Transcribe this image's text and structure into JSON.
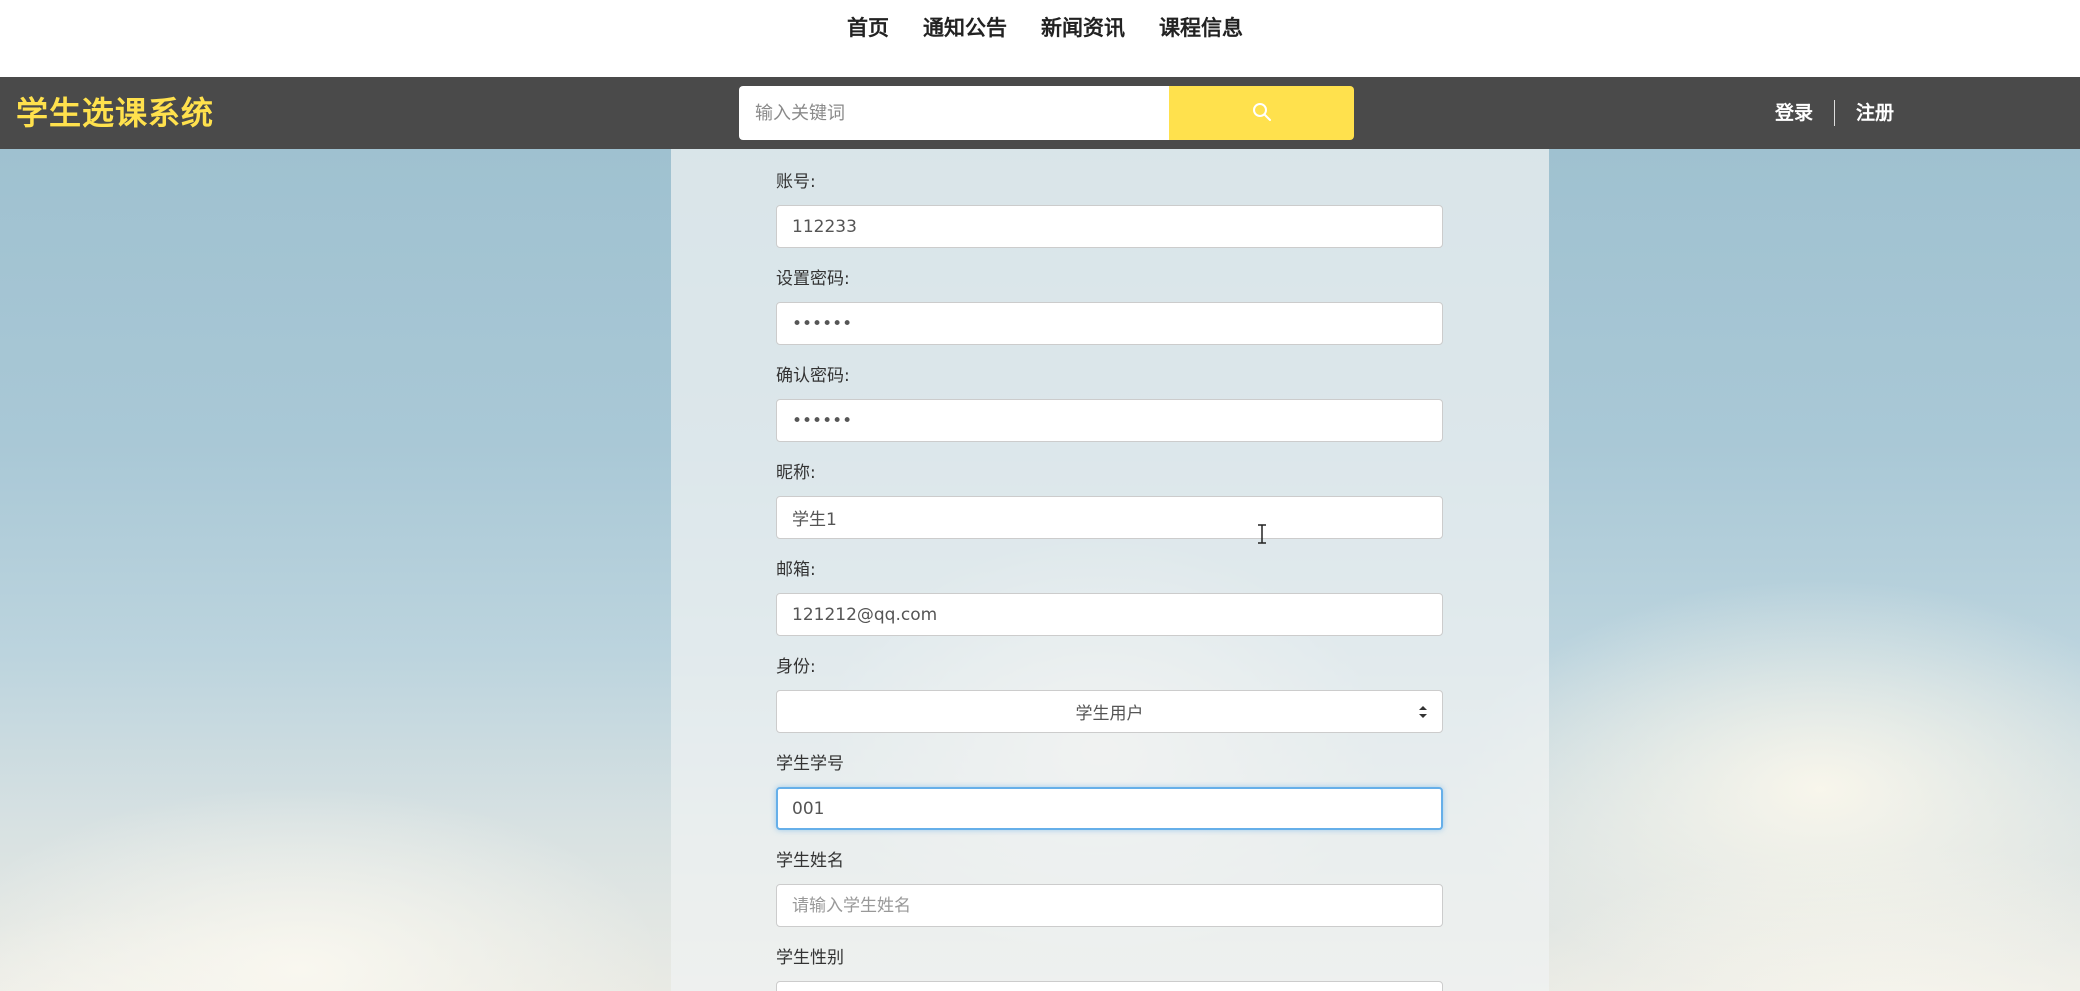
{
  "topnav": {
    "links": [
      "首页",
      "通知公告",
      "新闻资讯",
      "课程信息"
    ]
  },
  "header": {
    "brand": "学生选课系统",
    "search_placeholder": "输入关键词",
    "search_icon": "search-icon",
    "login": "登录",
    "register": "注册"
  },
  "colors": {
    "accent": "#ffe14d",
    "header_bg": "#4a4a4a",
    "focus": "#66afe9"
  },
  "form": {
    "account": {
      "label": "账号:",
      "value": "112233"
    },
    "password": {
      "label": "设置密码:",
      "value": "••••••"
    },
    "confirm_password": {
      "label": "确认密码:",
      "value": "••••••"
    },
    "nickname": {
      "label": "昵称:",
      "value": "学生1"
    },
    "email": {
      "label": "邮箱:",
      "value": "121212@qq.com"
    },
    "role": {
      "label": "身份:",
      "selected": "学生用户"
    },
    "student_no": {
      "label": "学生学号",
      "value": "001"
    },
    "student_name": {
      "label": "学生姓名",
      "placeholder": "请输入学生姓名"
    },
    "student_gender": {
      "label": "学生性别"
    }
  }
}
